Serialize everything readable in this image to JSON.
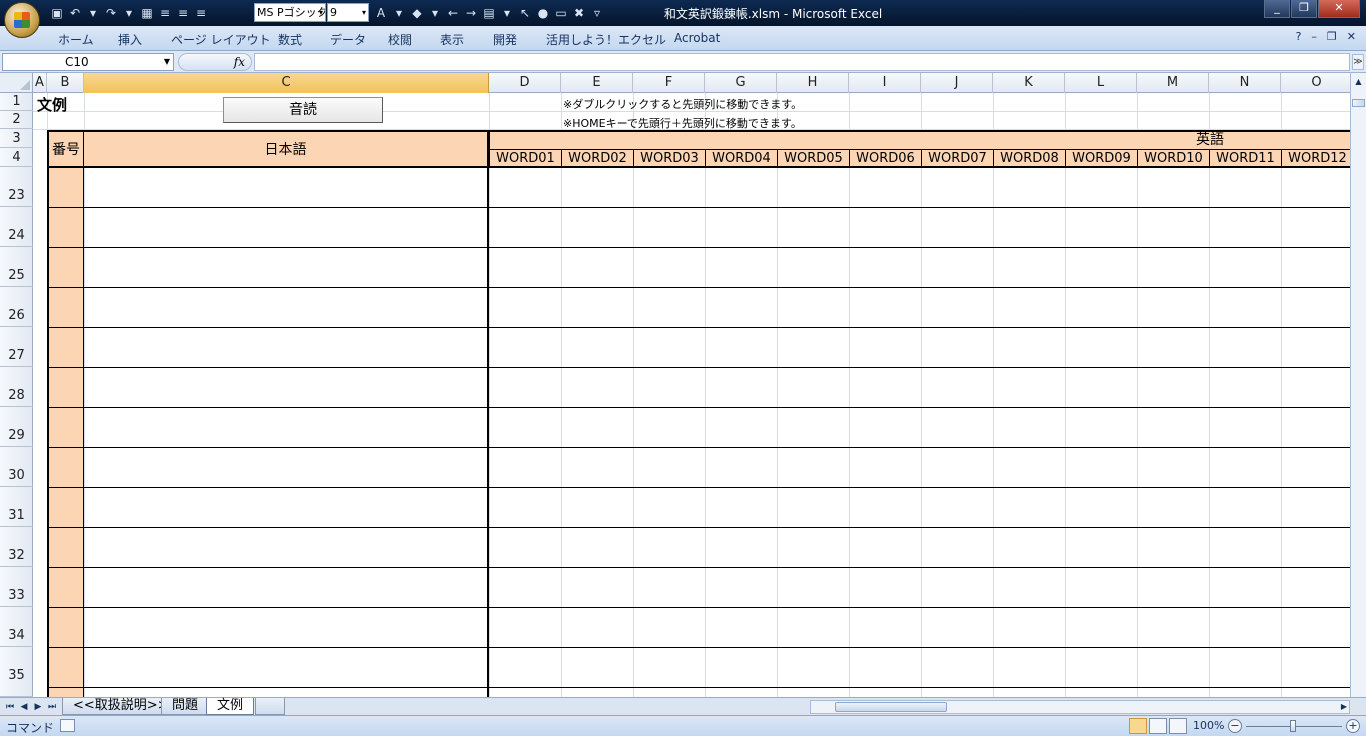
{
  "app": {
    "window_title": "和文英訳鍛錬帳.xlsm - Microsoft Excel",
    "font_name": "MS Pゴシック",
    "font_size": "9",
    "window_controls": [
      "_",
      "❐",
      "✕"
    ]
  },
  "ribbon": {
    "tabs": [
      "ホーム",
      "挿入",
      "ページ レイアウト",
      "数式",
      "データ",
      "校閲",
      "表示",
      "開発",
      "活用しよう！エクセル",
      "Acrobat"
    ],
    "right_icons": [
      "?",
      "–",
      "❐",
      "✕"
    ]
  },
  "formula_bar": {
    "name_box": "C10",
    "fx_label": "fx",
    "formula": ""
  },
  "columns": [
    "A",
    "B",
    "C",
    "D",
    "E",
    "F",
    "G",
    "H",
    "I",
    "J",
    "K",
    "L",
    "M",
    "N",
    "O"
  ],
  "selected_column": "C",
  "rows": [
    "1",
    "2",
    "3",
    "4",
    "23",
    "24",
    "25",
    "26",
    "27",
    "28",
    "29",
    "30",
    "31",
    "32",
    "33",
    "34",
    "35"
  ],
  "sheet": {
    "title": "文例",
    "button_label": "音読",
    "note1": "※ダブルクリックすると先頭列に移動できます。",
    "note2": "※HOMEキーで先頭行＋先頭列に移動できます。",
    "header_bangou": "番号",
    "header_nihongo": "日本語",
    "header_eigo": "英語",
    "word_headers": [
      "WORD01",
      "WORD02",
      "WORD03",
      "WORD04",
      "WORD05",
      "WORD06",
      "WORD07",
      "WORD08",
      "WORD09",
      "WORD10",
      "WORD11",
      "WORD12"
    ]
  },
  "sheet_tabs": [
    "<<取扱説明>>",
    "問題",
    "文例"
  ],
  "active_sheet": "文例",
  "status": {
    "mode": "コマンド",
    "zoom": "100%",
    "zoom_level_percent": 100
  }
}
